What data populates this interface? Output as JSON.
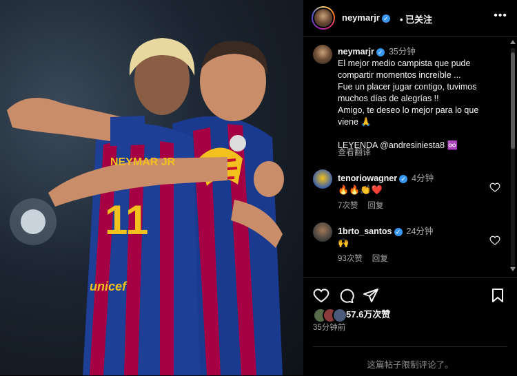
{
  "post": {
    "image_alt": "",
    "jersey_text": "NEYMAR JR",
    "jersey_number": "11",
    "sponsor": "unicef",
    "captain_band": true
  },
  "header": {
    "username": "neymarjr",
    "follow_status": "已关注",
    "more_label": "•••"
  },
  "caption": {
    "username": "neymarjr",
    "time": "35分钟",
    "lines": [
      "El mejor medio campista que pude",
      "compartir momentos increíble ...",
      "Fue un placer jugar contigo, tuvimos",
      "muchos días de alegrías !!",
      "Amigo, te deseo lo mejor para lo que",
      "viene 🙏",
      "",
      "LEYENDA @andresiniesta8 ♾️"
    ],
    "translate_label": "查看翻译"
  },
  "comments": [
    {
      "username": "tenoriowagner",
      "verified": true,
      "time": "4分钟",
      "text": "🔥🔥👏❤️",
      "likes": "7次赞",
      "reply": "回复"
    },
    {
      "username": "1brto_santos",
      "verified": true,
      "time": "24分钟",
      "text": "🙌",
      "likes": "93次赞",
      "reply": "回复"
    }
  ],
  "actions": {
    "likes_count": "57.6万次赞",
    "posted_time": "35分钟前",
    "comments_limited": "这篇帖子限制评论了。"
  },
  "colors": {
    "background": "#000000",
    "text": "#f5f5f5",
    "secondary_text": "#a8a8a8",
    "verified_blue": "#3897f0",
    "barca_blue": "#1a3a8f",
    "barca_red": "#a50044"
  }
}
